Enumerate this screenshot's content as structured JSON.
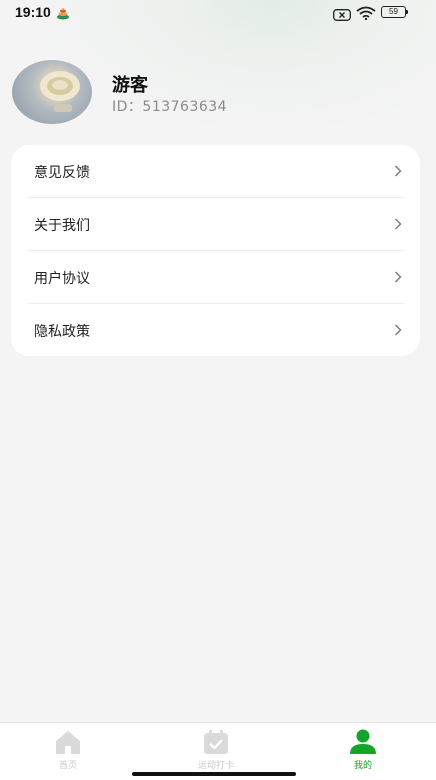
{
  "status_bar": {
    "time": "19:10",
    "battery": "59"
  },
  "profile": {
    "name": "游客",
    "id_text": "ID：513763634"
  },
  "menu": {
    "items": [
      {
        "label": "意见反馈"
      },
      {
        "label": "关于我们"
      },
      {
        "label": "用户协议"
      },
      {
        "label": "隐私政策"
      }
    ]
  },
  "bottom_nav": {
    "items": [
      {
        "label": "首页",
        "icon": "home-icon",
        "active": false
      },
      {
        "label": "运动打卡",
        "icon": "calendar-check-icon",
        "active": false
      },
      {
        "label": "我的",
        "icon": "person-icon",
        "active": true
      }
    ]
  },
  "colors": {
    "accent": "#13a42a",
    "inactive": "#c9c9c9",
    "background": "#f4f4f4"
  }
}
